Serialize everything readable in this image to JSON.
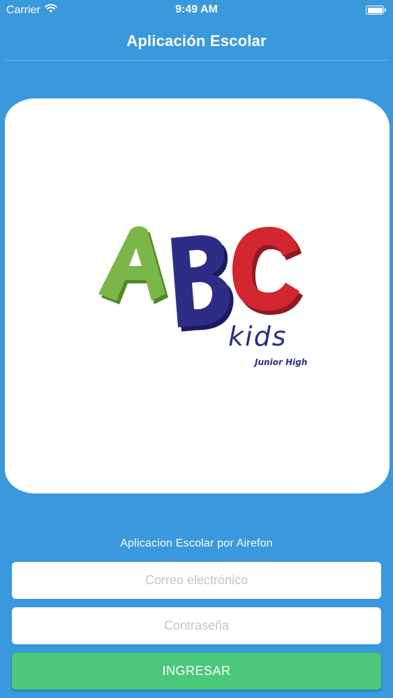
{
  "status_bar": {
    "carrier": "Carrier",
    "time": "9:49 AM",
    "wifi_icon": "wifi-icon",
    "battery_icon": "battery-icon",
    "battery_level": 1.0
  },
  "nav": {
    "title": "Aplicación Escolar"
  },
  "logo": {
    "letters": [
      "A",
      "B",
      "C"
    ],
    "subtitle": "kids",
    "caption": "Junior High",
    "colors": {
      "a": "#7ab648",
      "b": "#2e2d86",
      "c": "#d22630"
    }
  },
  "login": {
    "tagline": "Aplicacion Escolar por Airefon",
    "email_placeholder": "Correo electrónico",
    "password_placeholder": "Contraseña",
    "submit_label": "INGRESAR"
  },
  "colors": {
    "background": "#3a98dc",
    "button": "#4cc87b"
  }
}
